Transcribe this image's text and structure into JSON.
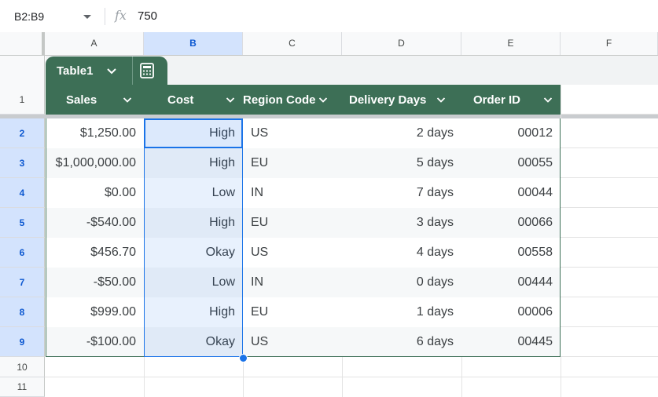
{
  "formula_bar": {
    "name_box": "B2:B9",
    "fx": "fx",
    "value": "750"
  },
  "columns": [
    "A",
    "B",
    "C",
    "D",
    "E",
    "F"
  ],
  "table": {
    "name": "Table1",
    "headers": [
      "Sales",
      "Cost",
      "Region Code",
      "Delivery Days",
      "Order ID"
    ],
    "rows": [
      {
        "row": "2",
        "sales": "$1,250.00",
        "cost": "High",
        "region": "US",
        "delivery": "2 days",
        "order": "00012"
      },
      {
        "row": "3",
        "sales": "$1,000,000.00",
        "cost": "High",
        "region": "EU",
        "delivery": "5 days",
        "order": "00055"
      },
      {
        "row": "4",
        "sales": "$0.00",
        "cost": "Low",
        "region": "IN",
        "delivery": "7 days",
        "order": "00044"
      },
      {
        "row": "5",
        "sales": "-$540.00",
        "cost": "High",
        "region": "EU",
        "delivery": "3 days",
        "order": "00066"
      },
      {
        "row": "6",
        "sales": "$456.70",
        "cost": "Okay",
        "region": "US",
        "delivery": "4 days",
        "order": "00558"
      },
      {
        "row": "7",
        "sales": "-$50.00",
        "cost": "Low",
        "region": "IN",
        "delivery": "0 days",
        "order": "00444"
      },
      {
        "row": "8",
        "sales": "$999.00",
        "cost": "High",
        "region": "EU",
        "delivery": "1 days",
        "order": "00006"
      },
      {
        "row": "9",
        "sales": "-$100.00",
        "cost": "Okay",
        "region": "US",
        "delivery": "6 days",
        "order": "00445"
      }
    ]
  },
  "row_numbers": {
    "header": "1",
    "empty": [
      "10",
      "11"
    ]
  },
  "colors": {
    "table_header": "#3d6f56",
    "selection": "#1a73e8",
    "header_selected": "#d3e3fd"
  }
}
